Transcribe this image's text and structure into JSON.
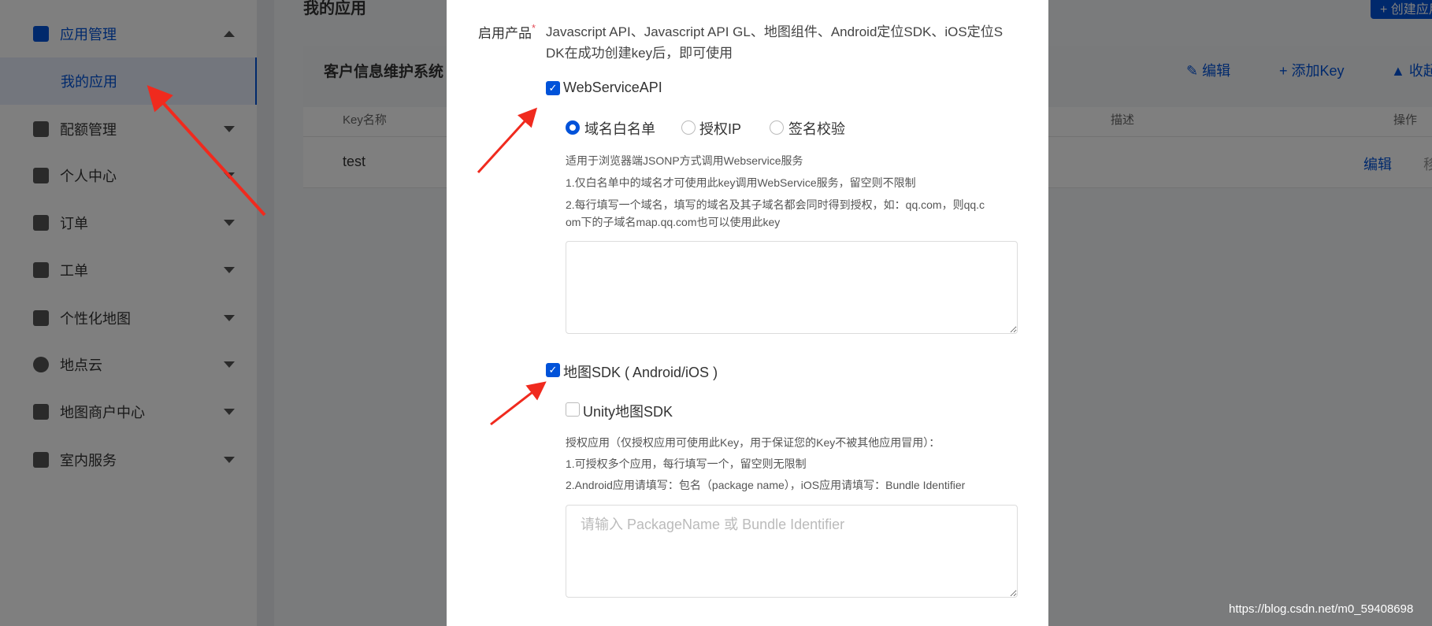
{
  "accent": "#0052d9",
  "sidebar": {
    "items": [
      {
        "label": "应用管理",
        "icon": "grid-icon",
        "expanded": true
      },
      {
        "label": "配额管理",
        "icon": "chart-icon"
      },
      {
        "label": "个人中心",
        "icon": "user-icon"
      },
      {
        "label": "订单",
        "icon": "clipboard-icon"
      },
      {
        "label": "工单",
        "icon": "ticket-icon"
      },
      {
        "label": "个性化地图",
        "icon": "custom-map-icon"
      },
      {
        "label": "地点云",
        "icon": "location-icon"
      },
      {
        "label": "地图商户中心",
        "icon": "store-icon"
      },
      {
        "label": "室内服务",
        "icon": "indoor-icon"
      }
    ],
    "sub_item": "我的应用"
  },
  "main": {
    "title": "我的应用",
    "create_button": "+ 创建应用",
    "card": {
      "name": "客户信息维护系统",
      "actions": {
        "edit": "编辑",
        "add_key": "添加Key",
        "collapse": "收起"
      },
      "columns": [
        "Key名称",
        "描述",
        "操作"
      ],
      "rows": [
        {
          "key_name": "test",
          "edit": "编辑",
          "move": "移"
        }
      ]
    }
  },
  "modal": {
    "products_label": "启用产品",
    "required_mark": "*",
    "products_note_1": "Javascript API、Javascript API GL、地图组件、Android定位SDK、iOS定位S",
    "products_note_2": "DK在成功创建key后，即可使用",
    "webservice": {
      "label": "WebServiceAPI",
      "checked": true,
      "radios": [
        {
          "label": "域名白名单",
          "selected": true
        },
        {
          "label": "授权IP",
          "selected": false
        },
        {
          "label": "签名校验",
          "selected": false
        }
      ],
      "help": [
        "适用于浏览器端JSONP方式调用Webservice服务",
        "1.仅白名单中的域名才可使用此key调用WebService服务，留空则不限制",
        "2.每行填写一个域名，填写的域名及其子域名都会同时得到授权，如：qq.com，则qq.c",
        "om下的子域名map.qq.com也可以使用此key"
      ],
      "textarea_value": ""
    },
    "sdk": {
      "label": "地图SDK ( Android/iOS )",
      "checked": true,
      "unity_label": "Unity地图SDK",
      "unity_checked": false,
      "help": [
        "授权应用（仅授权应用可使用此Key，用于保证您的Key不被其他应用冒用）：",
        "1.可授权多个应用，每行填写一个，留空则无限制",
        "2.Android应用请填写：包名（package name），iOS应用请填写：Bundle Identifier"
      ],
      "placeholder": "请输入 PackageName 或 Bundle Identifier"
    }
  },
  "watermark": "https://blog.csdn.net/m0_59408698"
}
